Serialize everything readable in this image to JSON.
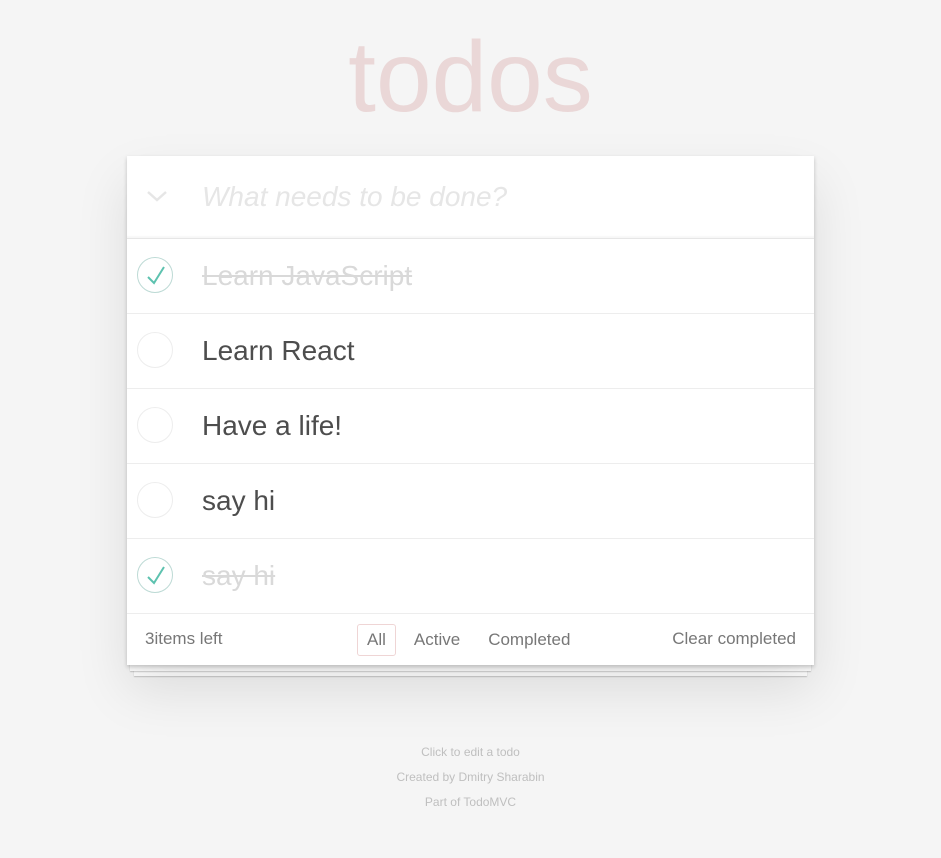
{
  "app": {
    "title": "todos"
  },
  "new_todo": {
    "placeholder": "What needs to be done?",
    "value": ""
  },
  "todos": [
    {
      "label": "Learn JavaScript",
      "completed": true
    },
    {
      "label": "Learn React",
      "completed": false
    },
    {
      "label": "Have a life!",
      "completed": false
    },
    {
      "label": "say hi",
      "completed": false
    },
    {
      "label": "say hi",
      "completed": true
    }
  ],
  "footer": {
    "count_text": "3items left",
    "filters": [
      {
        "label": "All",
        "selected": true
      },
      {
        "label": "Active",
        "selected": false
      },
      {
        "label": "Completed",
        "selected": false
      }
    ],
    "clear_label": "Clear completed"
  },
  "info": {
    "line1": "Click to edit a todo",
    "line2": "Created by Dmitry Sharabin",
    "line3": "Part of TodoMVC"
  },
  "colors": {
    "title": "#ead7d7",
    "check": "#5dc2af",
    "background": "#f5f5f5"
  },
  "icons": {
    "toggle_all": "chevron-down-icon",
    "check": "check-icon"
  }
}
